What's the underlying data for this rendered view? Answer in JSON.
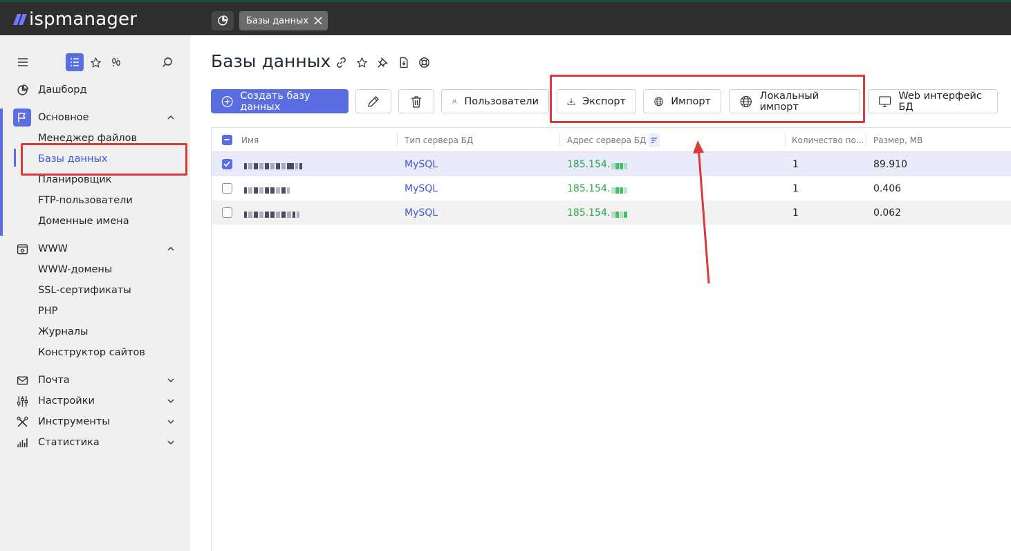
{
  "app": {
    "logo": "ispmanager"
  },
  "topbar": {
    "tab_label": "Базы данных"
  },
  "sidebar": {
    "dashboard": "Дашборд",
    "groups": [
      {
        "label": "Основное",
        "items": [
          "Менеджер файлов",
          "Базы данных",
          "Планировщик",
          "FTP-пользователи",
          "Доменные имена"
        ]
      },
      {
        "label": "WWW",
        "items": [
          "WWW-домены",
          "SSL-сертификаты",
          "PHP",
          "Журналы",
          "Конструктор сайтов"
        ]
      }
    ],
    "collapsed": [
      "Почта",
      "Настройки",
      "Инструменты",
      "Статистика"
    ],
    "active_item": "Базы данных"
  },
  "page": {
    "title": "Базы данных"
  },
  "toolbar": {
    "create": "Создать базу данных",
    "users": "Пользователи",
    "export": "Экспорт",
    "import": "Импорт",
    "local_import": "Локальный импорт",
    "web": "Web интерфейс БД"
  },
  "table": {
    "columns": [
      "Имя",
      "Тип сервера БД",
      "Адрес сервера БД",
      "Количество по...",
      "Размер, MB"
    ],
    "rows": [
      {
        "checked": true,
        "type": "MySQL",
        "address": "185.154.",
        "count": "1",
        "size": "89.910"
      },
      {
        "checked": false,
        "type": "MySQL",
        "address": "185.154.",
        "count": "1",
        "size": "0.406"
      },
      {
        "checked": false,
        "type": "MySQL",
        "address": "185.154.",
        "count": "1",
        "size": "0.062"
      }
    ]
  },
  "colors": {
    "accent": "#5b6ee1",
    "highlight": "#d93a3a",
    "ip": "#27a34a",
    "topbar": "#2f2f2f"
  }
}
